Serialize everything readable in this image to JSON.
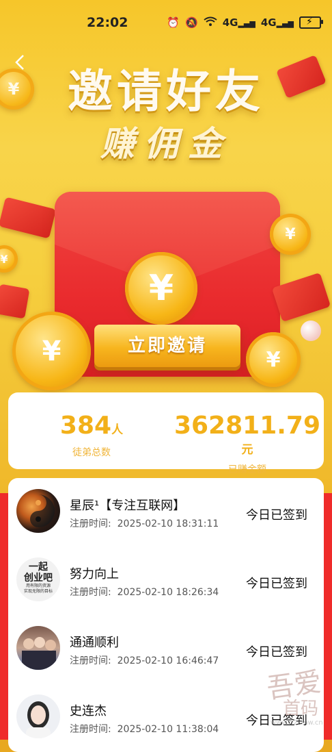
{
  "status_bar": {
    "time": "22:02",
    "signal1": "4G",
    "signal2": "4G"
  },
  "hero": {
    "title": "邀请好友",
    "subtitle": "赚佣金",
    "coin_symbol": "¥",
    "invite_button": "立即邀请"
  },
  "stats": {
    "followers_count": "384",
    "followers_unit": "人",
    "followers_label": "徒弟总数",
    "earned_amount": "362811.79",
    "earned_unit": "元",
    "earned_label": "已赚金额"
  },
  "members": [
    {
      "name": "星辰¹【专注互联网】",
      "reg_label": "注册时间:",
      "reg_time": "2025-02-10 18:31:11",
      "status": "今日已签到"
    },
    {
      "name": "努力向上",
      "reg_label": "注册时间:",
      "reg_time": "2025-02-10 18:26:34",
      "status": "今日已签到",
      "avatar_text1": "一起",
      "avatar_text2": "创业吧",
      "avatar_text3": "用有限的资源",
      "avatar_text4": "实现无限的目标"
    },
    {
      "name": "通通顺利",
      "reg_label": "注册时间:",
      "reg_time": "2025-02-10 16:46:47",
      "status": "今日已签到"
    },
    {
      "name": "史连杰",
      "reg_label": "注册时间:",
      "reg_time": "2025-02-10 11:38:04",
      "status": "今日已签到"
    }
  ],
  "watermark": {
    "line1": "吾爱",
    "line2": "首码",
    "url": "www.52smw.cn"
  },
  "colors": {
    "accent": "#f2b019",
    "red": "#ef2b2a"
  }
}
